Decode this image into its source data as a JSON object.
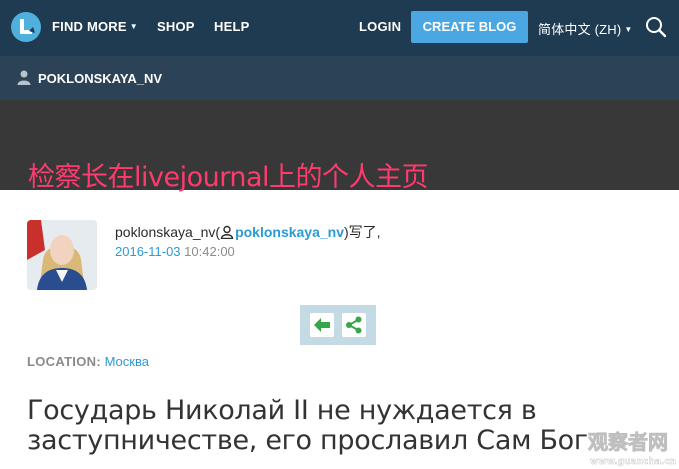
{
  "nav": {
    "find_more": "FIND MORE",
    "shop": "SHOP",
    "help": "HELP",
    "login": "LOGIN",
    "create_blog": "CREATE BLOG",
    "language": "简体中文 (ZH)",
    "logo_icon": "livejournal-logo-icon",
    "search_icon": "search-icon"
  },
  "userbar": {
    "username": "POKLONSKAYA_NV"
  },
  "overlay_caption": "检察长在livejournal上的个人主页",
  "post": {
    "author_prefix": "poklonskaya_nv(",
    "author_link": "poklonskaya_nv",
    "author_suffix": ")写了,",
    "date": "2016-11-03",
    "time": "10:42:00",
    "location_label": "LOCATION:",
    "location_value": "Москва",
    "title": "Государь Николай II не нуждается в заступничестве, его прославил Сам Бог"
  },
  "watermark": {
    "line1": "观察者网",
    "line2": "www.guancha.cn"
  },
  "colors": {
    "nav_bg": "#1f3b52",
    "userbar_bg": "#2c4257",
    "accent_blue": "#4aa7e1",
    "link_blue": "#2b9bd4",
    "caption_pink": "#ff3a6e",
    "action_green": "#35a64a"
  }
}
